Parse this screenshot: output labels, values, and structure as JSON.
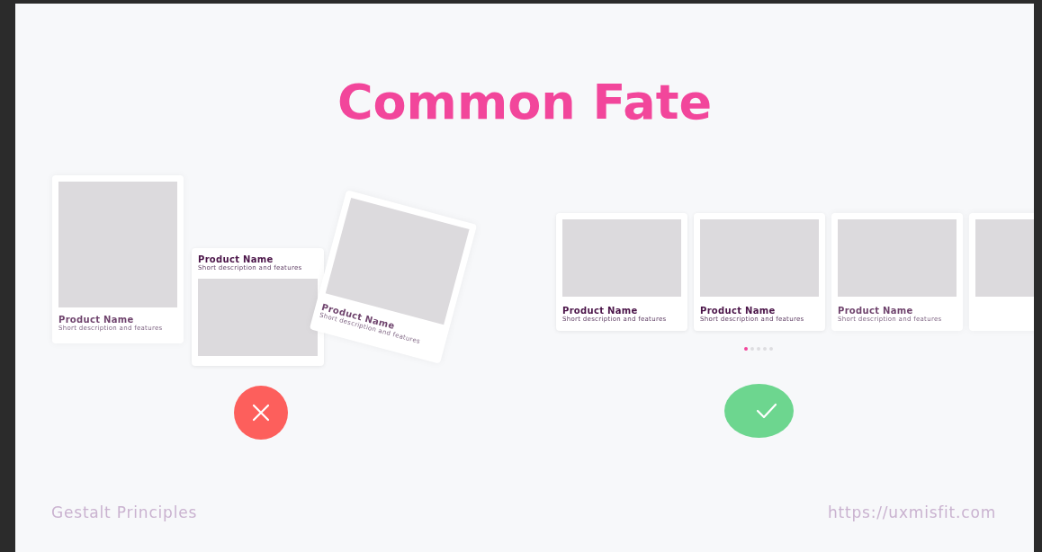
{
  "title": "Common Fate",
  "bad_example": {
    "correct": false,
    "cards": [
      {
        "kind": "blurred",
        "name": "Product Name",
        "description": "Short description and features"
      },
      {
        "kind": "text-first",
        "name": "Product Name",
        "description": "Short description and features"
      },
      {
        "kind": "tilted",
        "name": "Product Name",
        "description": "Short description and features"
      }
    ]
  },
  "good_example": {
    "correct": true,
    "cards": [
      {
        "kind": "sharp",
        "name": "Product Name",
        "description": "Short description and features"
      },
      {
        "kind": "sharp",
        "name": "Product Name",
        "description": "Short description and features"
      },
      {
        "kind": "blurred",
        "name": "Product Name",
        "description": "Short description and features"
      },
      {
        "kind": "cut"
      }
    ],
    "dots": [
      {
        "selected": true
      },
      {
        "selected": false
      },
      {
        "selected": false
      },
      {
        "selected": false
      },
      {
        "selected": false
      }
    ]
  },
  "footer": {
    "left": "Gestalt Principles",
    "right": "https://uxmisfit.com"
  }
}
